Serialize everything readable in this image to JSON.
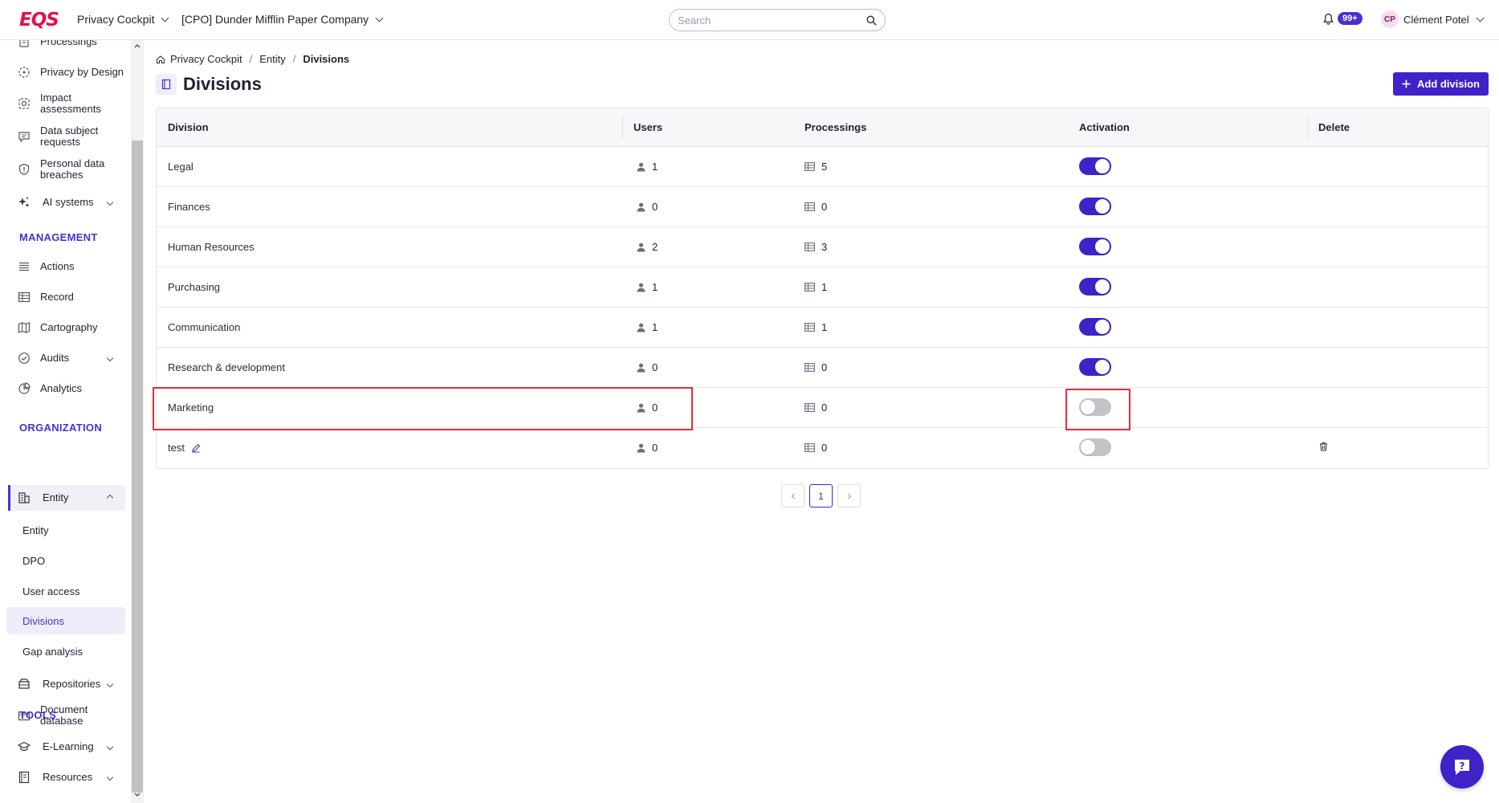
{
  "topbar": {
    "logo": "EQS",
    "product": "Privacy Cockpit",
    "company": "[CPO] Dunder Mifflin Paper Company",
    "search_placeholder": "Search",
    "notifications": "99+",
    "user_initials": "CP",
    "user_name": "Clément Potel"
  },
  "sidebar": {
    "items_top": [
      {
        "label": "Processings",
        "icon": "document-icon"
      },
      {
        "label": "Privacy by Design",
        "icon": "dashed-circle-icon"
      },
      {
        "label": "Impact assessments",
        "icon": "target-icon"
      },
      {
        "label": "Data subject requests",
        "icon": "chat-icon"
      },
      {
        "label": "Personal data breaches",
        "icon": "shield-icon"
      },
      {
        "label": "AI systems",
        "icon": "sparkle-icon"
      }
    ],
    "management_title": "MANAGEMENT",
    "management": [
      {
        "label": "Actions",
        "icon": "list-icon"
      },
      {
        "label": "Record",
        "icon": "table-icon"
      },
      {
        "label": "Cartography",
        "icon": "map-icon"
      },
      {
        "label": "Audits",
        "icon": "check-circle-icon"
      },
      {
        "label": "Analytics",
        "icon": "pie-chart-icon"
      }
    ],
    "organization_title": "ORGANIZATION",
    "entity_label": "Entity",
    "entity_sub": [
      "Entity",
      "DPO",
      "User access",
      "Divisions",
      "Gap analysis"
    ],
    "repositories": "Repositories",
    "document_db": "Document database",
    "tools_title": "TOOLS",
    "elearning": "E-Learning",
    "resources": "Resources"
  },
  "breadcrumb": {
    "home": "Privacy Cockpit",
    "entity": "Entity",
    "current": "Divisions"
  },
  "page": {
    "title": "Divisions",
    "add_button": "Add division"
  },
  "table": {
    "headers": {
      "division": "Division",
      "users": "Users",
      "processings": "Processings",
      "activation": "Activation",
      "delete": "Delete"
    },
    "rows": [
      {
        "division": "Legal",
        "users": "1",
        "processings": "5",
        "active": true
      },
      {
        "division": "Finances",
        "users": "0",
        "processings": "0",
        "active": true
      },
      {
        "division": "Human Resources",
        "users": "2",
        "processings": "3",
        "active": true
      },
      {
        "division": "Purchasing",
        "users": "1",
        "processings": "1",
        "active": true
      },
      {
        "division": "Communication",
        "users": "1",
        "processings": "1",
        "active": true
      },
      {
        "division": "Research & development",
        "users": "0",
        "processings": "0",
        "active": true
      },
      {
        "division": "Marketing",
        "users": "0",
        "processings": "0",
        "active": false
      },
      {
        "division": "test",
        "users": "0",
        "processings": "0",
        "active": false
      }
    ]
  },
  "pagination": {
    "prev": "<",
    "page": "1",
    "next": ">"
  },
  "colors": {
    "accent": "#3f22c8",
    "brand": "#e3104e",
    "highlight": "#e0303a"
  }
}
